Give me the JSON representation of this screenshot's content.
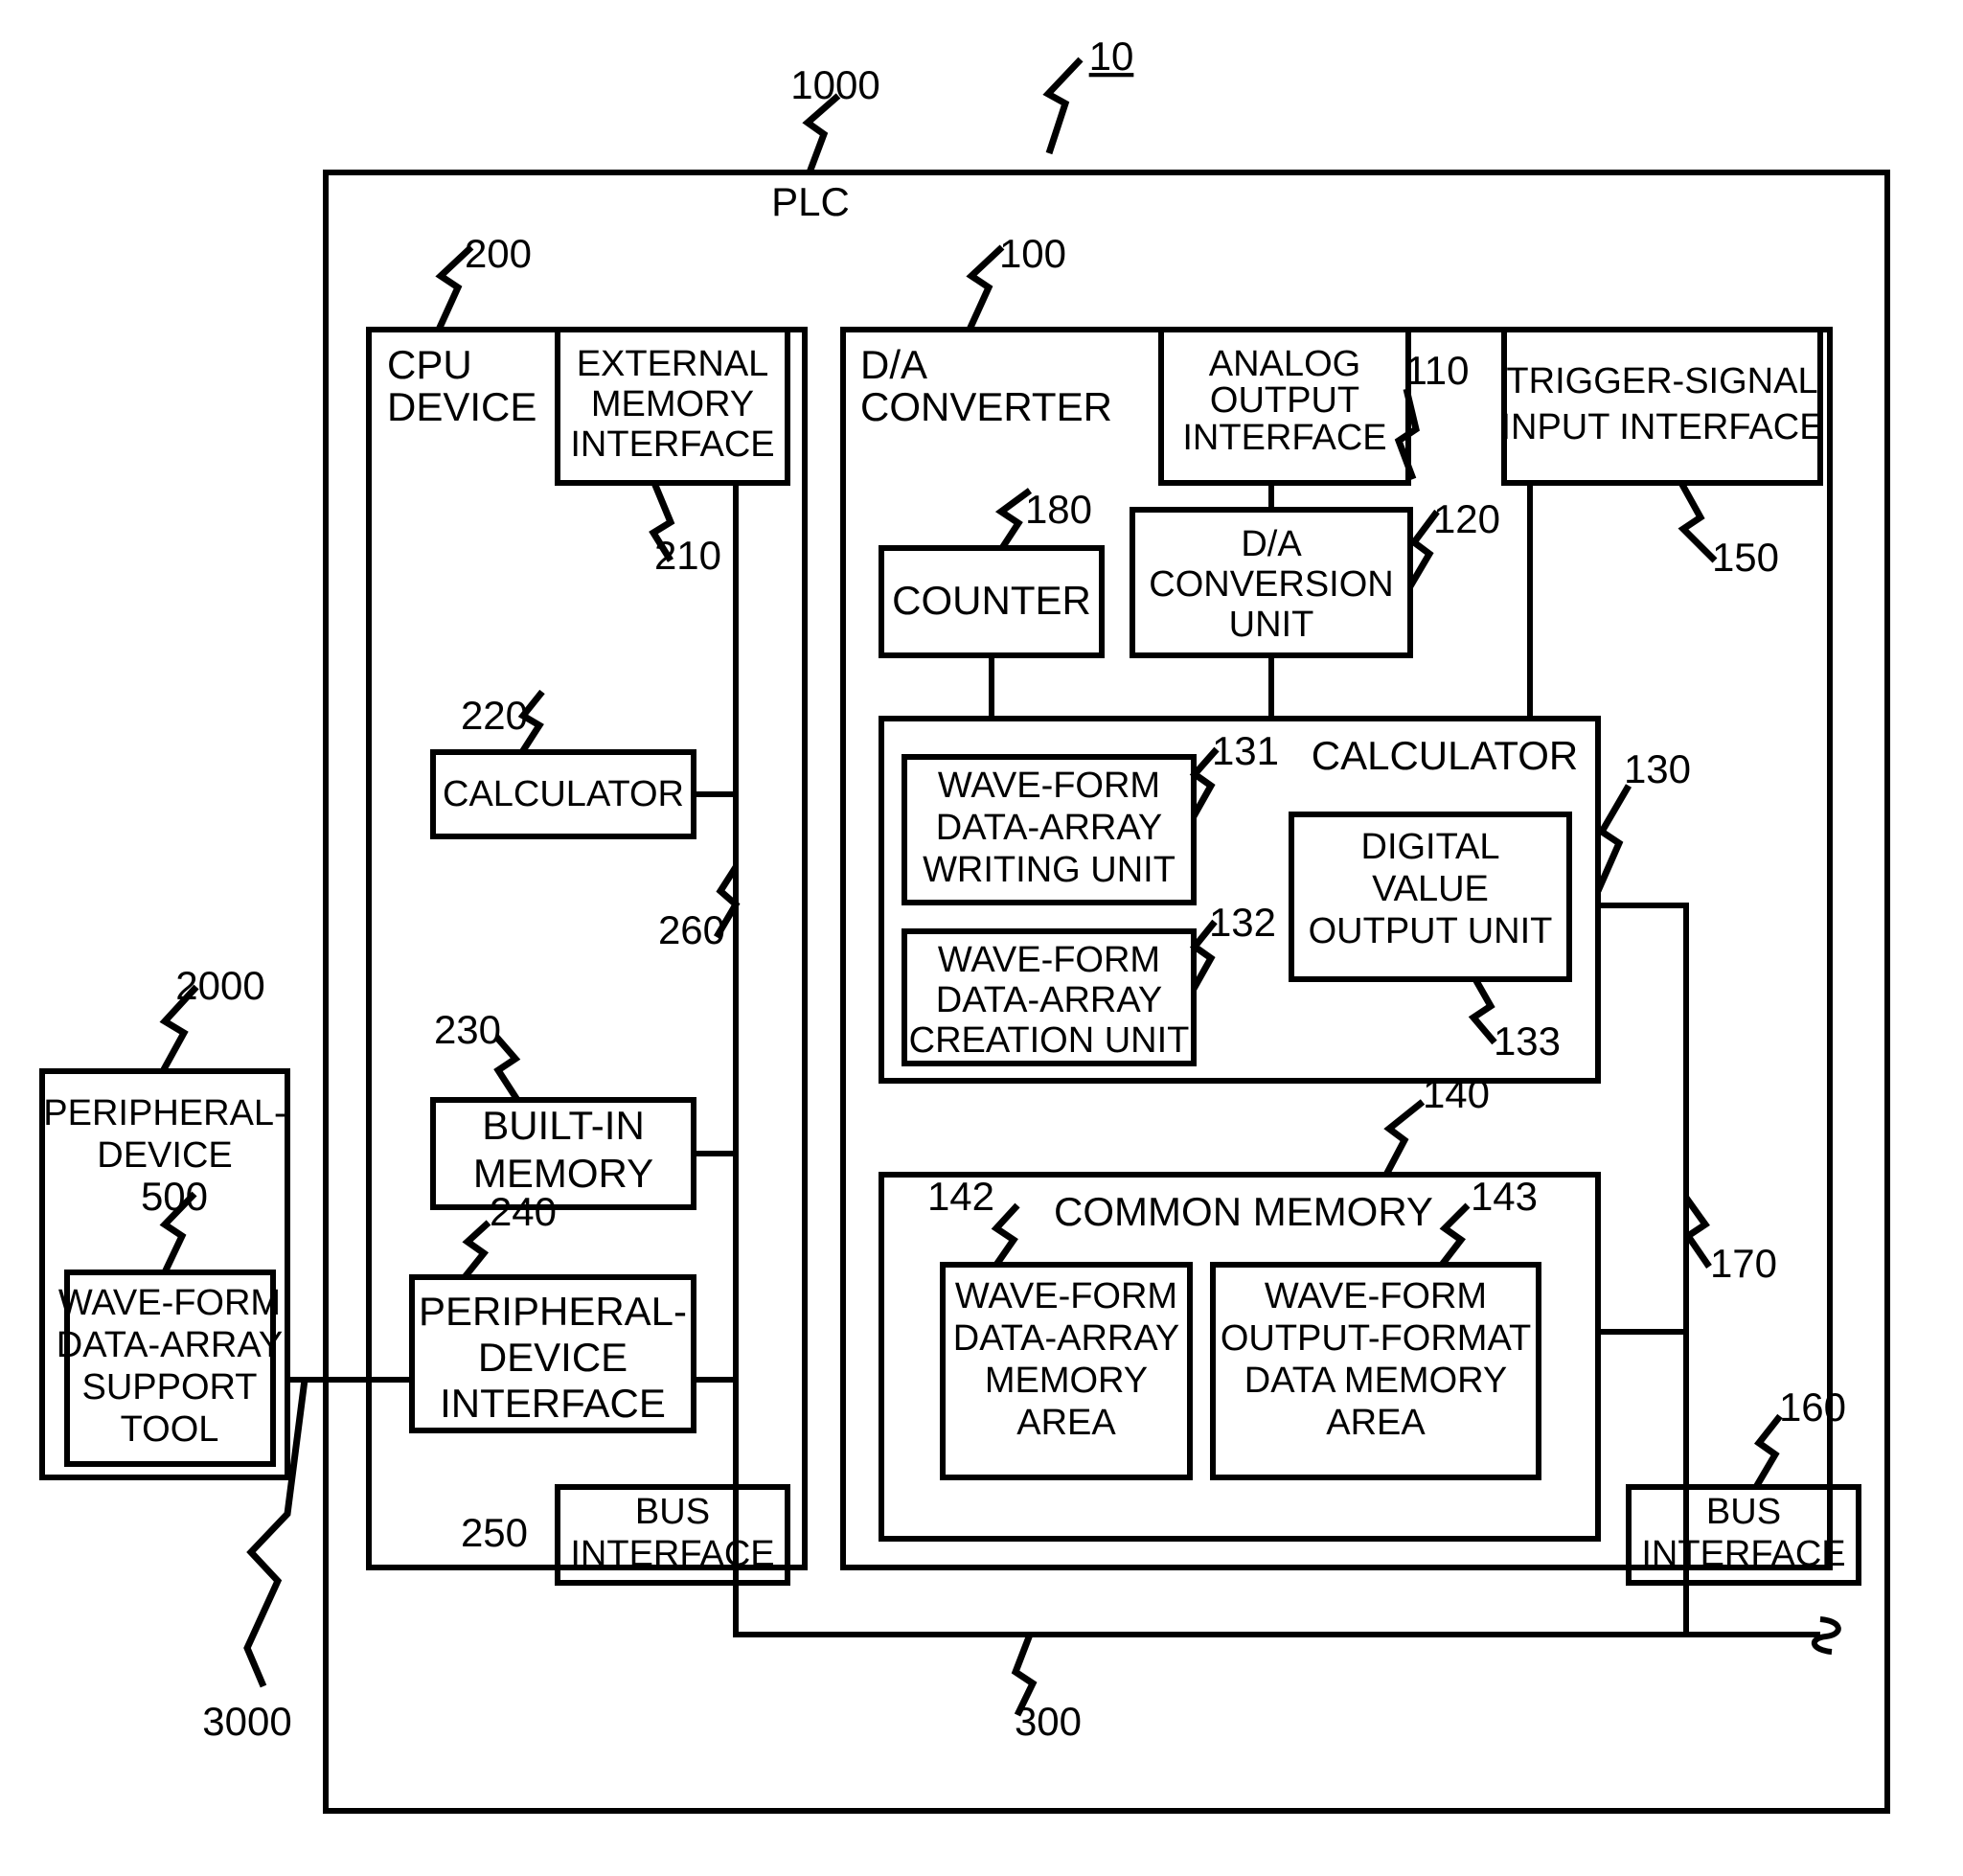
{
  "figure": {
    "figure_ref": "10",
    "plc_ref": "1000",
    "plc_label": "PLC"
  },
  "cpu_device": {
    "ref": "200",
    "title_line1": "CPU",
    "title_line2": "DEVICE",
    "external_memory_interface": {
      "ref": "210",
      "line1": "EXTERNAL",
      "line2": "MEMORY",
      "line3": "INTERFACE"
    },
    "calculator": {
      "ref": "220",
      "label": "CALCULATOR"
    },
    "internal_bus_ref": "260",
    "built_in_memory": {
      "ref": "230",
      "line1": "BUILT-IN",
      "line2": "MEMORY"
    },
    "peripheral_device_interface": {
      "ref": "240",
      "line1": "PERIPHERAL-",
      "line2": "DEVICE",
      "line3": "INTERFACE"
    },
    "bus_interface": {
      "ref": "250",
      "line1": "BUS",
      "line2": "INTERFACE"
    }
  },
  "da_converter": {
    "ref": "100",
    "title_line1": "D/A",
    "title_line2": "CONVERTER",
    "analog_output_interface": {
      "ref": "110",
      "line1": "ANALOG",
      "line2": "OUTPUT",
      "line3": "INTERFACE"
    },
    "trigger_signal_input_interface": {
      "ref": "150",
      "line1": "TRIGGER-SIGNAL",
      "line2": "INPUT INTERFACE"
    },
    "counter": {
      "ref": "180",
      "label": "COUNTER"
    },
    "da_conversion_unit": {
      "ref": "120",
      "line1": "D/A",
      "line2": "CONVERSION",
      "line3": "UNIT"
    },
    "calculator": {
      "ref": "130",
      "label": "CALCULATOR",
      "waveform_data_array_writing_unit": {
        "ref": "131",
        "line1": "WAVE-FORM",
        "line2": "DATA-ARRAY",
        "line3": "WRITING UNIT"
      },
      "waveform_data_array_creation_unit": {
        "ref": "132",
        "line1": "WAVE-FORM",
        "line2": "DATA-ARRAY",
        "line3": "CREATION UNIT"
      },
      "digital_value_output_unit": {
        "ref": "133",
        "line1": "DIGITAL",
        "line2": "VALUE",
        "line3": "OUTPUT UNIT"
      }
    },
    "common_memory": {
      "ref": "140",
      "label": "COMMON MEMORY",
      "waveform_data_array_memory_area": {
        "ref": "142",
        "line1": "WAVE-FORM",
        "line2": "DATA-ARRAY",
        "line3": "MEMORY",
        "line4": "AREA"
      },
      "waveform_output_format_data_memory_area": {
        "ref": "143",
        "line1": "WAVE-FORM",
        "line2": "OUTPUT-FORMAT",
        "line3": "DATA MEMORY",
        "line4": "AREA"
      }
    },
    "internal_bus_ref": "170",
    "bus_interface": {
      "ref": "160",
      "line1": "BUS",
      "line2": "INTERFACE"
    }
  },
  "peripheral_device": {
    "ref": "2000",
    "line1": "PERIPHERAL-",
    "line2": "DEVICE",
    "support_tool": {
      "ref": "500",
      "line1": "WAVE-FORM",
      "line2": "DATA-ARRAY",
      "line3": "SUPPORT",
      "line4": "TOOL"
    }
  },
  "connections": {
    "cable_ref": "3000",
    "system_bus_ref": "300"
  }
}
